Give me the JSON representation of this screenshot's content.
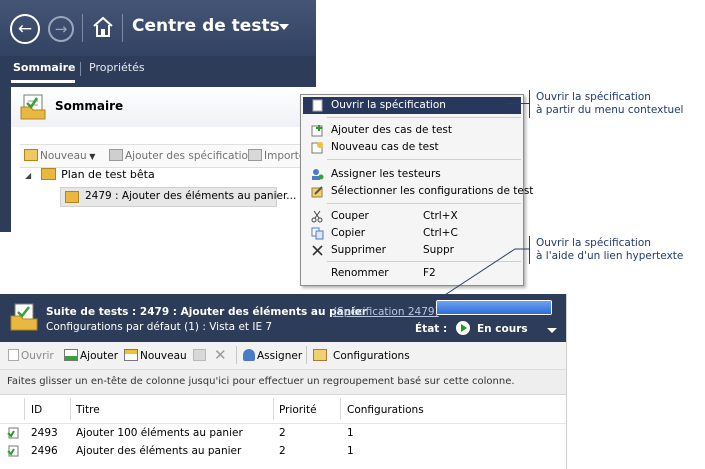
{
  "top_window": {
    "title": "Centre de tests",
    "tabs": [
      "Sommaire",
      "Propriétés"
    ],
    "summary_title": "Sommaire",
    "toolbar": {
      "new": "Nouveau",
      "add_specs": "Ajouter des spécifications",
      "import": "Importer"
    },
    "tree": {
      "plan": "Plan de test bêta",
      "suite": "2479 : Ajouter des éléments au panier..."
    }
  },
  "context_menu": {
    "open_spec": "Ouvrir la spécification",
    "add_cases": "Ajouter des cas de test",
    "new_case": "Nouveau cas de test",
    "assign_testers": "Assigner les testeurs",
    "select_configs": "Sélectionner les configurations de test",
    "cut": "Couper",
    "cut_sc": "Ctrl+X",
    "copy": "Copier",
    "copy_sc": "Ctrl+C",
    "delete": "Supprimer",
    "delete_sc": "Suppr",
    "rename": "Renommer",
    "rename_sc": "F2"
  },
  "callouts": {
    "context_line1": "Ouvrir la spécification",
    "context_line2": "à partir du menu contextuel",
    "link_line1": "Ouvrir la spécification",
    "link_line2": "à l'aide d'un lien hypertexte"
  },
  "bottom_panel": {
    "suite_label": "Suite de tests :  2479 : Ajouter des éléments au panier",
    "spec_link": "(Spécification 2479)",
    "configs": "Configurations par défaut (1) : Vista et IE 7",
    "state_label": "État :",
    "state_value": "En cours",
    "progress": 1.0,
    "toolbar": {
      "open": "Ouvrir",
      "add": "Ajouter",
      "new": "Nouveau",
      "assign": "Assigner",
      "configurations": "Configurations"
    },
    "group_hint": "Faites glisser un en-tête de colonne jusqu'ici pour effectuer un regroupement basé sur cette colonne.",
    "columns": [
      "ID",
      "Titre",
      "Priorité",
      "Configurations"
    ],
    "rows": [
      {
        "id": "2493",
        "title": "Ajouter 100 éléments au panier",
        "priority": "2",
        "configs": "1"
      },
      {
        "id": "2496",
        "title": "Ajouter des éléments au panier",
        "priority": "2",
        "configs": "1"
      }
    ]
  },
  "colors": {
    "nav_dark": "#2d3c58",
    "menu_highlight": "#28385c",
    "progress": "#2d6ed8",
    "link": "#1f3a72"
  }
}
